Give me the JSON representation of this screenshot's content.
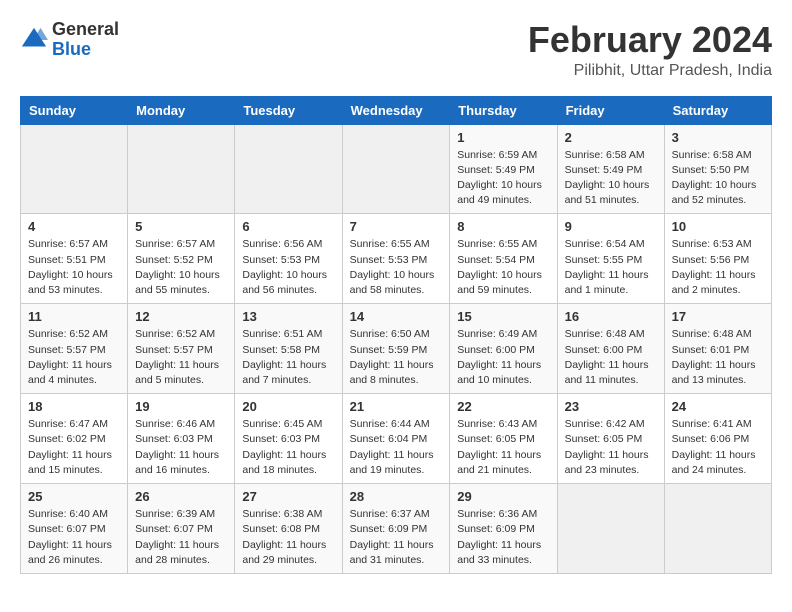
{
  "logo": {
    "general": "General",
    "blue": "Blue"
  },
  "header": {
    "month_year": "February 2024",
    "location": "Pilibhit, Uttar Pradesh, India"
  },
  "days_of_week": [
    "Sunday",
    "Monday",
    "Tuesday",
    "Wednesday",
    "Thursday",
    "Friday",
    "Saturday"
  ],
  "weeks": [
    [
      {
        "day": "",
        "detail": ""
      },
      {
        "day": "",
        "detail": ""
      },
      {
        "day": "",
        "detail": ""
      },
      {
        "day": "",
        "detail": ""
      },
      {
        "day": "1",
        "detail": "Sunrise: 6:59 AM\nSunset: 5:49 PM\nDaylight: 10 hours and 49 minutes."
      },
      {
        "day": "2",
        "detail": "Sunrise: 6:58 AM\nSunset: 5:49 PM\nDaylight: 10 hours and 51 minutes."
      },
      {
        "day": "3",
        "detail": "Sunrise: 6:58 AM\nSunset: 5:50 PM\nDaylight: 10 hours and 52 minutes."
      }
    ],
    [
      {
        "day": "4",
        "detail": "Sunrise: 6:57 AM\nSunset: 5:51 PM\nDaylight: 10 hours and 53 minutes."
      },
      {
        "day": "5",
        "detail": "Sunrise: 6:57 AM\nSunset: 5:52 PM\nDaylight: 10 hours and 55 minutes."
      },
      {
        "day": "6",
        "detail": "Sunrise: 6:56 AM\nSunset: 5:53 PM\nDaylight: 10 hours and 56 minutes."
      },
      {
        "day": "7",
        "detail": "Sunrise: 6:55 AM\nSunset: 5:53 PM\nDaylight: 10 hours and 58 minutes."
      },
      {
        "day": "8",
        "detail": "Sunrise: 6:55 AM\nSunset: 5:54 PM\nDaylight: 10 hours and 59 minutes."
      },
      {
        "day": "9",
        "detail": "Sunrise: 6:54 AM\nSunset: 5:55 PM\nDaylight: 11 hours and 1 minute."
      },
      {
        "day": "10",
        "detail": "Sunrise: 6:53 AM\nSunset: 5:56 PM\nDaylight: 11 hours and 2 minutes."
      }
    ],
    [
      {
        "day": "11",
        "detail": "Sunrise: 6:52 AM\nSunset: 5:57 PM\nDaylight: 11 hours and 4 minutes."
      },
      {
        "day": "12",
        "detail": "Sunrise: 6:52 AM\nSunset: 5:57 PM\nDaylight: 11 hours and 5 minutes."
      },
      {
        "day": "13",
        "detail": "Sunrise: 6:51 AM\nSunset: 5:58 PM\nDaylight: 11 hours and 7 minutes."
      },
      {
        "day": "14",
        "detail": "Sunrise: 6:50 AM\nSunset: 5:59 PM\nDaylight: 11 hours and 8 minutes."
      },
      {
        "day": "15",
        "detail": "Sunrise: 6:49 AM\nSunset: 6:00 PM\nDaylight: 11 hours and 10 minutes."
      },
      {
        "day": "16",
        "detail": "Sunrise: 6:48 AM\nSunset: 6:00 PM\nDaylight: 11 hours and 11 minutes."
      },
      {
        "day": "17",
        "detail": "Sunrise: 6:48 AM\nSunset: 6:01 PM\nDaylight: 11 hours and 13 minutes."
      }
    ],
    [
      {
        "day": "18",
        "detail": "Sunrise: 6:47 AM\nSunset: 6:02 PM\nDaylight: 11 hours and 15 minutes."
      },
      {
        "day": "19",
        "detail": "Sunrise: 6:46 AM\nSunset: 6:03 PM\nDaylight: 11 hours and 16 minutes."
      },
      {
        "day": "20",
        "detail": "Sunrise: 6:45 AM\nSunset: 6:03 PM\nDaylight: 11 hours and 18 minutes."
      },
      {
        "day": "21",
        "detail": "Sunrise: 6:44 AM\nSunset: 6:04 PM\nDaylight: 11 hours and 19 minutes."
      },
      {
        "day": "22",
        "detail": "Sunrise: 6:43 AM\nSunset: 6:05 PM\nDaylight: 11 hours and 21 minutes."
      },
      {
        "day": "23",
        "detail": "Sunrise: 6:42 AM\nSunset: 6:05 PM\nDaylight: 11 hours and 23 minutes."
      },
      {
        "day": "24",
        "detail": "Sunrise: 6:41 AM\nSunset: 6:06 PM\nDaylight: 11 hours and 24 minutes."
      }
    ],
    [
      {
        "day": "25",
        "detail": "Sunrise: 6:40 AM\nSunset: 6:07 PM\nDaylight: 11 hours and 26 minutes."
      },
      {
        "day": "26",
        "detail": "Sunrise: 6:39 AM\nSunset: 6:07 PM\nDaylight: 11 hours and 28 minutes."
      },
      {
        "day": "27",
        "detail": "Sunrise: 6:38 AM\nSunset: 6:08 PM\nDaylight: 11 hours and 29 minutes."
      },
      {
        "day": "28",
        "detail": "Sunrise: 6:37 AM\nSunset: 6:09 PM\nDaylight: 11 hours and 31 minutes."
      },
      {
        "day": "29",
        "detail": "Sunrise: 6:36 AM\nSunset: 6:09 PM\nDaylight: 11 hours and 33 minutes."
      },
      {
        "day": "",
        "detail": ""
      },
      {
        "day": "",
        "detail": ""
      }
    ]
  ]
}
